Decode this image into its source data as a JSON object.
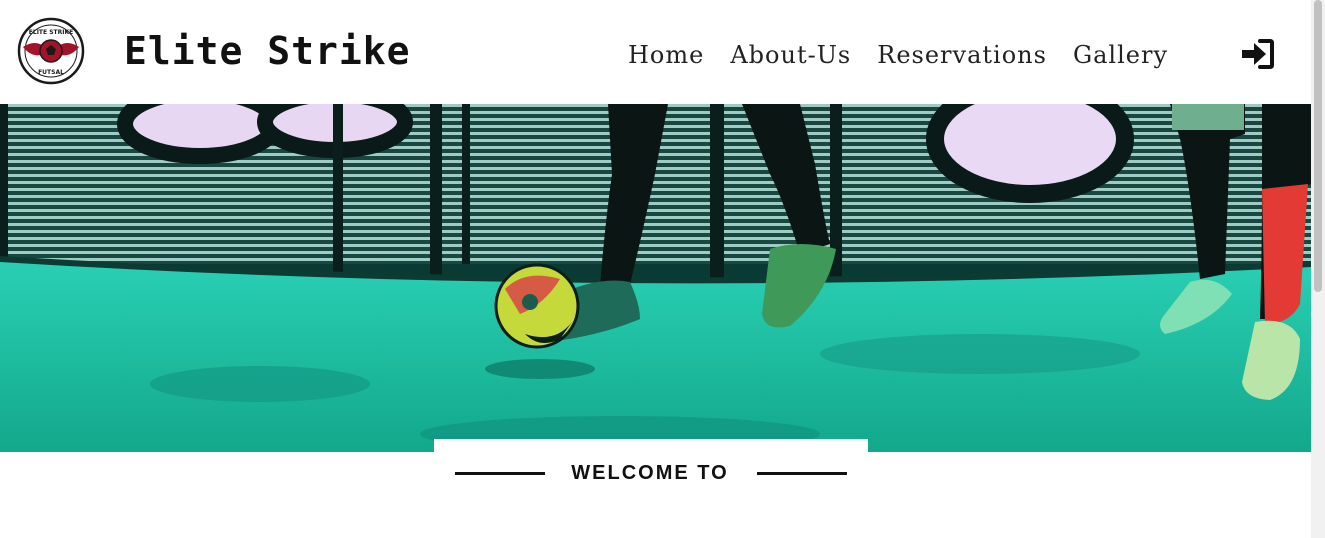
{
  "header": {
    "brand": "Elite Strike",
    "logo_text_top": "ELITE STRIKE",
    "logo_text_bottom": "FUTSAL",
    "nav": [
      {
        "label": "Home"
      },
      {
        "label": "About-Us"
      },
      {
        "label": "Reservations"
      },
      {
        "label": "Gallery"
      }
    ],
    "login_icon": "sign-in-icon"
  },
  "welcome": {
    "text": "WELCOME TO"
  },
  "colors": {
    "hero_teal": "#1fb8a0",
    "logo_red": "#a3142a",
    "text_dark": "#111111"
  }
}
